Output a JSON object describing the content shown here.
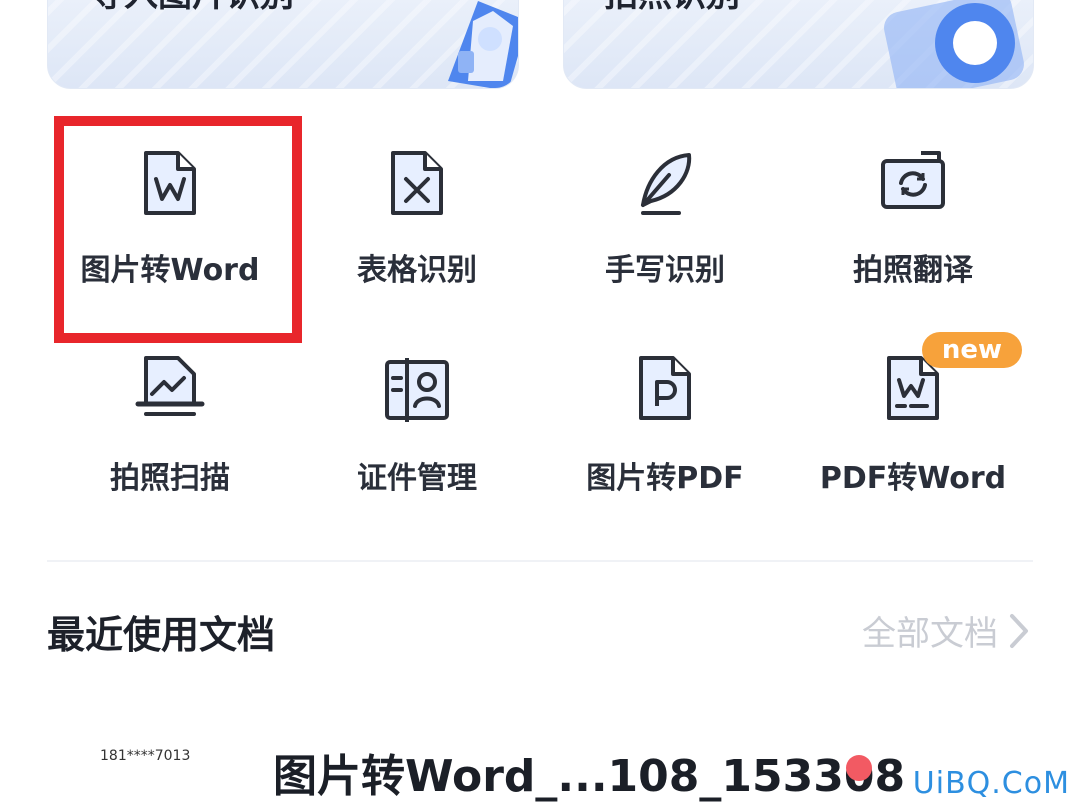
{
  "cards": {
    "import_title": "导入图片识别",
    "photo_title": "拍照识别"
  },
  "tools": [
    {
      "label": "图片转Word",
      "icon": "word-doc-icon"
    },
    {
      "label": "表格识别",
      "icon": "excel-doc-icon"
    },
    {
      "label": "手写识别",
      "icon": "feather-pen-icon"
    },
    {
      "label": "拍照翻译",
      "icon": "camera-refresh-icon"
    },
    {
      "label": "拍照扫描",
      "icon": "scan-image-icon"
    },
    {
      "label": "证件管理",
      "icon": "id-card-icon"
    },
    {
      "label": "图片转PDF",
      "icon": "pdf-doc-icon"
    },
    {
      "label": "PDF转Word",
      "icon": "pdf-to-word-icon",
      "badge": "new"
    }
  ],
  "recent": {
    "title": "最近使用文档",
    "all_docs": "全部文档",
    "docs": [
      {
        "owner": "181****7013",
        "name": "图片转Word_...108_153308"
      }
    ]
  },
  "watermark": "UiBQ.CoM",
  "colors": {
    "highlight": "#e8262b",
    "badge": "#f7a23b",
    "accent_blue": "#4f86ee",
    "unread_dot": "#f25a63"
  }
}
